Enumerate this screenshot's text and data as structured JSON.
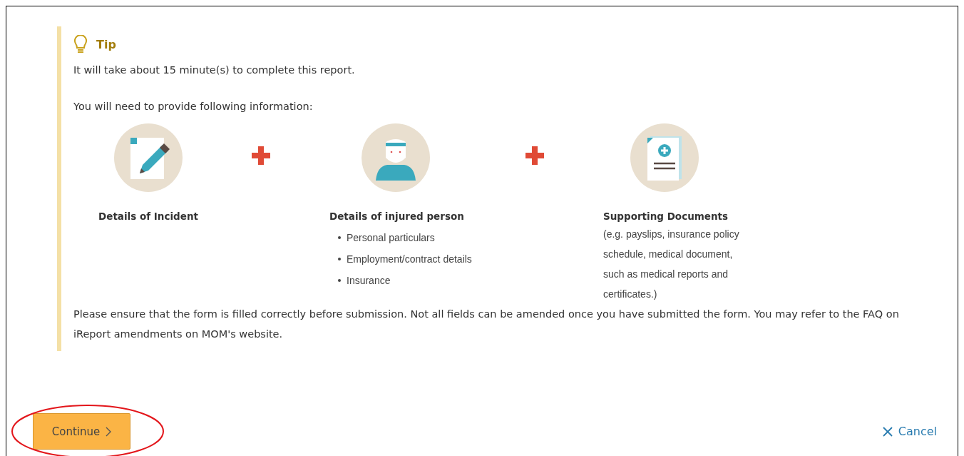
{
  "tip": {
    "title": "Tip",
    "lines": [
      "It will take about 15 minute(s) to complete this report.",
      "You will need to provide following information:"
    ]
  },
  "items": [
    {
      "kind": "incident",
      "title": "Details of Incident"
    },
    {
      "kind": "person",
      "title": "Details of injured person",
      "bullets": [
        "Personal particulars",
        "Employment/contract details",
        "Insurance"
      ]
    },
    {
      "kind": "documents",
      "title": "Supporting Documents",
      "note": "(e.g. payslips, insurance policy schedule, medical document, such as medical reports and certificates.)"
    }
  ],
  "notice": "Please ensure that the form is filled correctly before submission. Not all fields can be amended once you have submitted the form. You may refer to the FAQ on iReport amendments on MOM's website.",
  "actions": {
    "continue": "Continue",
    "cancel": "Cancel"
  }
}
